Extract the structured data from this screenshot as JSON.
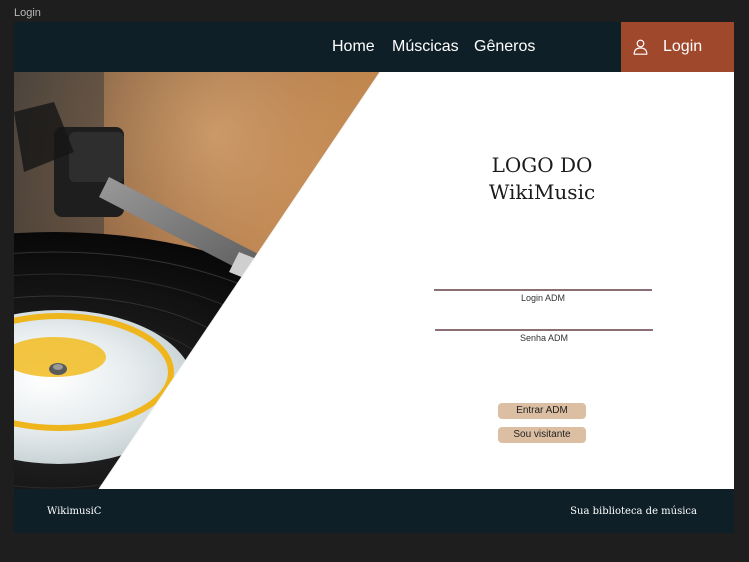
{
  "frame": {
    "label": "Login"
  },
  "navbar": {
    "links": [
      "Home",
      "Múscicas",
      "Gêneros"
    ],
    "login_label": "Login",
    "login_icon": "user-icon",
    "accent_color": "#a0482c",
    "background_color": "#0f1f28"
  },
  "hero": {
    "image_subject": "vinyl-record-turntable"
  },
  "login_panel": {
    "logo_text": "LOGO DO\nWikiMusic",
    "login_caption": "Login  ADM",
    "password_caption": "Senha ADM",
    "enter_button": "Entrar ADM",
    "visitor_button": "Sou visitante",
    "button_color": "#dcbfa3"
  },
  "footer": {
    "brand": "WikimusiC",
    "tagline": "Sua biblioteca de música"
  }
}
